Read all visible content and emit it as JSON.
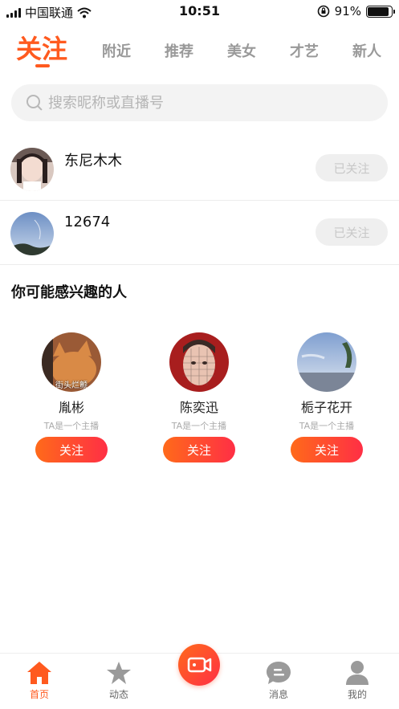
{
  "status_bar": {
    "carrier": "中国联通",
    "time": "10:51",
    "battery": "91%",
    "battery_level": 0.91
  },
  "tabs": [
    {
      "label": "关注",
      "active": true
    },
    {
      "label": "附近",
      "active": false
    },
    {
      "label": "推荐",
      "active": false
    },
    {
      "label": "美女",
      "active": false
    },
    {
      "label": "才艺",
      "active": false
    },
    {
      "label": "新人",
      "active": false
    }
  ],
  "search": {
    "placeholder": "搜索昵称或直播号",
    "value": ""
  },
  "following": [
    {
      "name": "东尼木木",
      "button": "已关注"
    },
    {
      "name": "12674",
      "button": "已关注"
    }
  ],
  "suggestions": {
    "title": "你可能感兴趣的人",
    "items": [
      {
        "name": "胤彬",
        "desc": "TA是一个主播",
        "button": "关注",
        "avatar_caption": "街头烂颤"
      },
      {
        "name": "陈奕迅",
        "desc": "TA是一个主播",
        "button": "关注"
      },
      {
        "name": "栀子花开",
        "desc": "TA是一个主播",
        "button": "关注"
      }
    ]
  },
  "tabbar": {
    "items": [
      {
        "label": "首页",
        "icon": "home-icon",
        "active": true
      },
      {
        "label": "动态",
        "icon": "star-icon",
        "active": false
      },
      {
        "label": "消息",
        "icon": "message-icon",
        "active": false
      },
      {
        "label": "我的",
        "icon": "profile-icon",
        "active": false
      }
    ],
    "center_icon": "video-camera-icon"
  },
  "colors": {
    "accent": "#ff5a1f",
    "gradient_end": "#ff2f45",
    "muted": "#999999"
  }
}
